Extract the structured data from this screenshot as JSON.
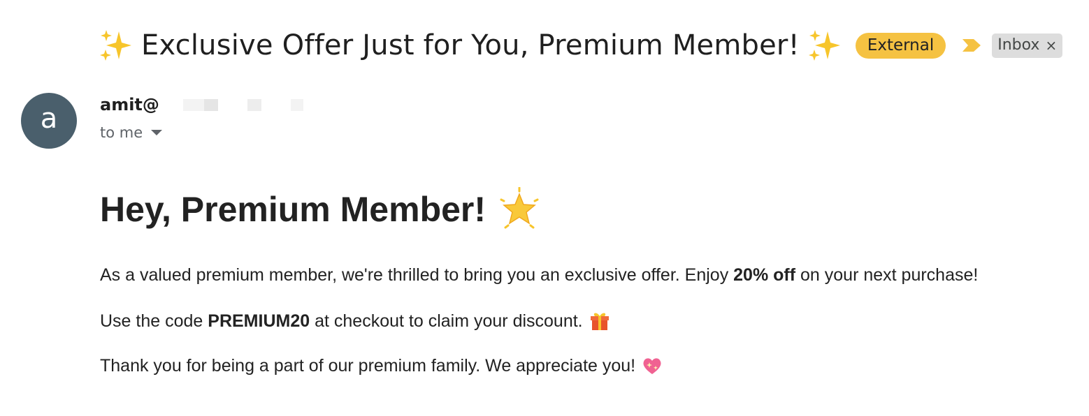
{
  "email": {
    "subject": "Exclusive Offer Just for You, Premium Member!",
    "labels": {
      "external": "External",
      "inbox": "Inbox",
      "inbox_close": "×"
    },
    "sender": {
      "avatar_letter": "a",
      "name": "amit@",
      "recipient": "to me"
    },
    "body": {
      "headline": "Hey, Premium Member!",
      "p1_before": "As a valued premium member, we're thrilled to bring you an exclusive offer. Enjoy",
      "p1_bold": "20% off",
      "p1_after": "on your next purchase!",
      "p2_before": "Use the code",
      "p2_bold": "PREMIUM20",
      "p2_after": "at checkout to claim your discount.",
      "p3": "Thank you for being a part of our premium family. We appreciate you!"
    }
  },
  "icons": {
    "subject_left": "sparkles-icon",
    "subject_right": "sparkles-icon",
    "importance": "importance-marker-icon",
    "headline": "glowing-star-icon",
    "p2": "gift-icon",
    "p3": "sparkling-heart-icon",
    "recipient_toggle": "chevron-down-icon"
  },
  "colors": {
    "external_badge": "#f5c242",
    "inbox_label": "#dddddd",
    "avatar": "#4a5f6c",
    "importance": "#f5c242"
  }
}
